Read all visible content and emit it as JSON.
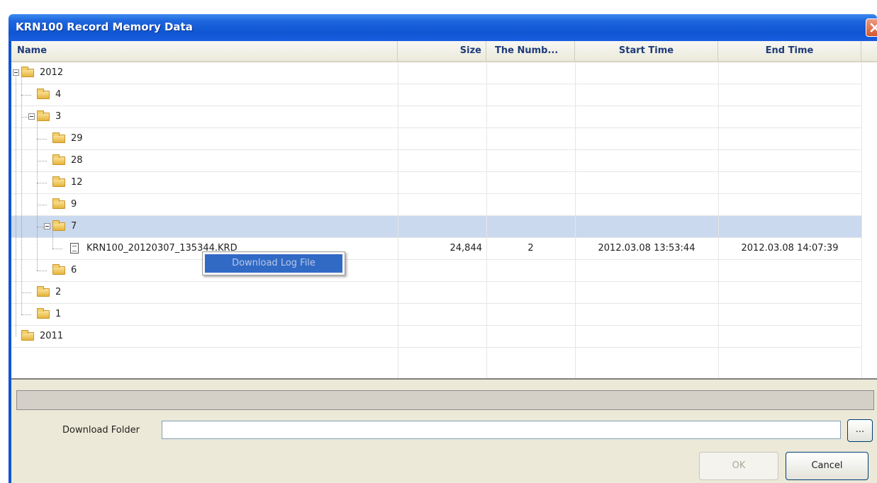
{
  "window": {
    "title": "KRN100 Record Memory Data"
  },
  "columns": {
    "name": "Name",
    "size": "Size",
    "number": "The Numb...",
    "start_time": "Start Time",
    "end_time": "End Time"
  },
  "tree": [
    {
      "label": "2012",
      "type": "folder",
      "level": 0,
      "expanded": true
    },
    {
      "label": "4",
      "type": "folder",
      "level": 1
    },
    {
      "label": "3",
      "type": "folder",
      "level": 1,
      "expanded": true
    },
    {
      "label": "29",
      "type": "folder",
      "level": 2
    },
    {
      "label": "28",
      "type": "folder",
      "level": 2
    },
    {
      "label": "12",
      "type": "folder",
      "level": 2
    },
    {
      "label": "9",
      "type": "folder",
      "level": 2
    },
    {
      "label": "7",
      "type": "folder",
      "level": 2,
      "expanded": true,
      "selected": true
    },
    {
      "label": "KRN100_20120307_135344.KRD",
      "type": "file",
      "level": 3,
      "size": "24,844",
      "number": "2",
      "start_time": "2012.03.08 13:53:44",
      "end_time": "2012.03.08 14:07:39"
    },
    {
      "label": "6",
      "type": "folder",
      "level": 2
    },
    {
      "label": "2",
      "type": "folder",
      "level": 1
    },
    {
      "label": "1",
      "type": "folder",
      "level": 1
    },
    {
      "label": "2011",
      "type": "folder",
      "level": 0
    }
  ],
  "context_menu": {
    "item": "Download Log File"
  },
  "download": {
    "label": "Download Folder",
    "value": "",
    "browse_label": "..."
  },
  "buttons": {
    "ok": "OK",
    "cancel": "Cancel"
  },
  "colors": {
    "titlebar": "#0f55d2",
    "selected_row": "#cad9ee",
    "menu_highlight": "#316ac5"
  }
}
